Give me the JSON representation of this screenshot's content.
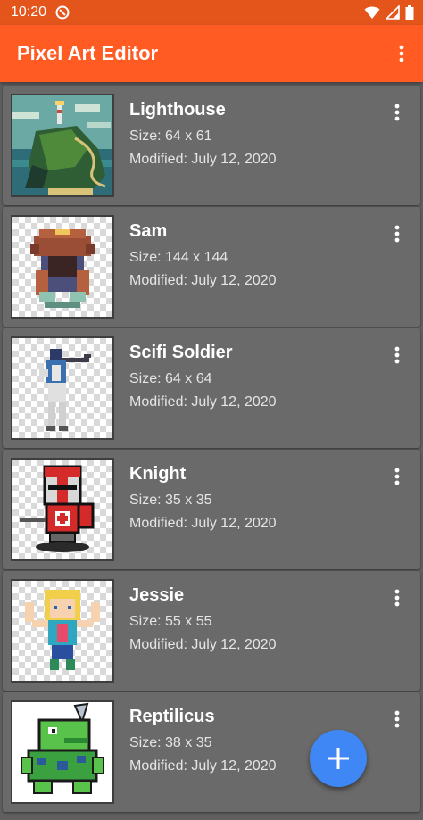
{
  "status_bar": {
    "time": "10:20",
    "icons": [
      "app-notification-icon",
      "wifi-icon",
      "signal-icon",
      "battery-icon"
    ]
  },
  "app_bar": {
    "title": "Pixel Art Editor",
    "menu_icon": "more-vert-icon"
  },
  "items": [
    {
      "title": "Lighthouse",
      "size": "Size: 64 x 61",
      "modified": "Modified: July 12, 2020"
    },
    {
      "title": "Sam",
      "size": "Size: 144 x 144",
      "modified": "Modified: July 12, 2020"
    },
    {
      "title": "Scifi Soldier",
      "size": "Size: 64 x 64",
      "modified": "Modified: July 12, 2020"
    },
    {
      "title": "Knight",
      "size": "Size: 35 x 35",
      "modified": "Modified: July 12, 2020"
    },
    {
      "title": "Jessie",
      "size": "Size: 55 x 55",
      "modified": "Modified: July 12, 2020"
    },
    {
      "title": "Reptilicus",
      "size": "Size: 38 x 35",
      "modified": "Modified: July 12, 2020"
    }
  ],
  "fab": {
    "icon": "add-icon"
  },
  "colors": {
    "status_bar": "#e4551c",
    "app_bar": "#ff5b22",
    "background": "#5f5f5f",
    "card": "#6a6a6a",
    "fab": "#3f87f5"
  }
}
